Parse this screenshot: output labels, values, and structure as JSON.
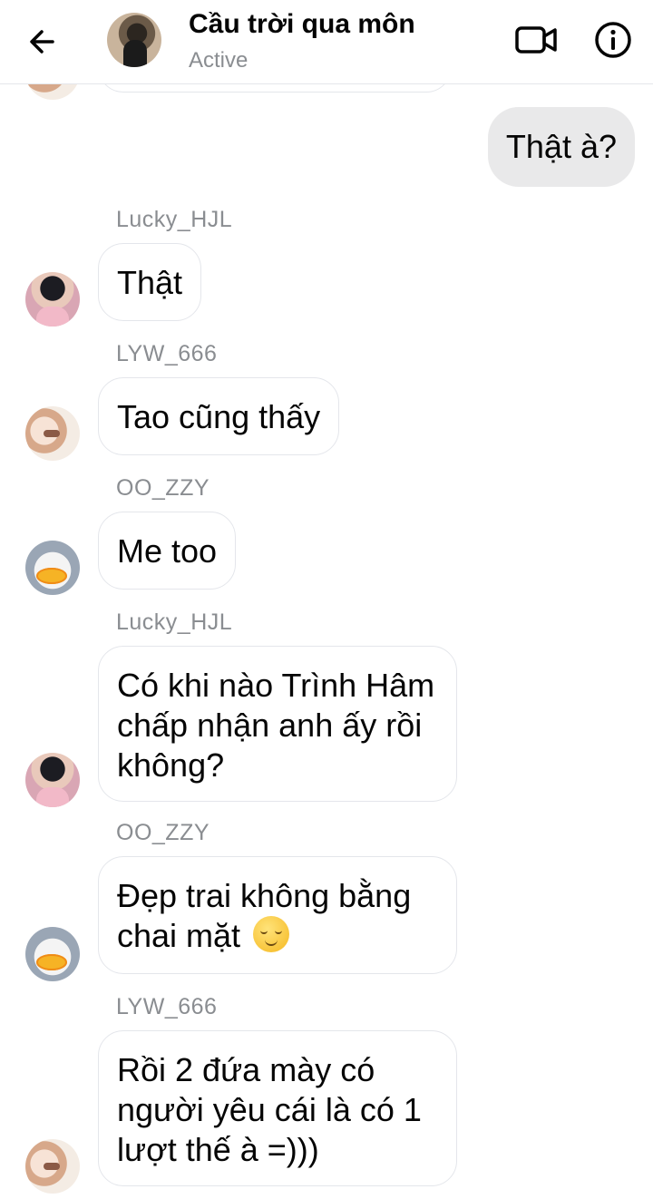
{
  "header": {
    "title": "Cầu trời qua môn",
    "status": "Active",
    "back_icon": "arrow-left-icon",
    "video_icon": "video-camera-icon",
    "info_icon": "info-icon"
  },
  "messages": [
    {
      "id": "m1",
      "direction": "outgoing",
      "text": "Thật à?"
    },
    {
      "id": "m2",
      "direction": "incoming",
      "sender": "Lucky_HJL",
      "lines": [
        "Thật"
      ]
    },
    {
      "id": "m3",
      "direction": "incoming",
      "sender": "LYW_666",
      "lines": [
        "Tao cũng thấy"
      ]
    },
    {
      "id": "m4",
      "direction": "incoming",
      "sender": "OO_ZZY",
      "lines": [
        "Me too"
      ]
    },
    {
      "id": "m5",
      "direction": "incoming",
      "sender": "Lucky_HJL",
      "lines": [
        "Có khi nào Trình Hâm",
        "chấp nhận anh ấy rồi",
        "không?"
      ]
    },
    {
      "id": "m6",
      "direction": "incoming",
      "sender": "OO_ZZY",
      "lines": [
        "Đẹp trai không bằng",
        "chai mặt"
      ],
      "emoji": "relieved-face-emoji"
    },
    {
      "id": "m7",
      "direction": "incoming",
      "sender": "LYW_666",
      "lines": [
        "Rồi 2 đứa mày có",
        "người yêu cái là có 1",
        "lượt thế à =)))"
      ]
    }
  ],
  "colors": {
    "incoming_border": "#e4e6eb",
    "outgoing_bg": "#e9e9ea",
    "muted_text": "#8a8d91"
  }
}
